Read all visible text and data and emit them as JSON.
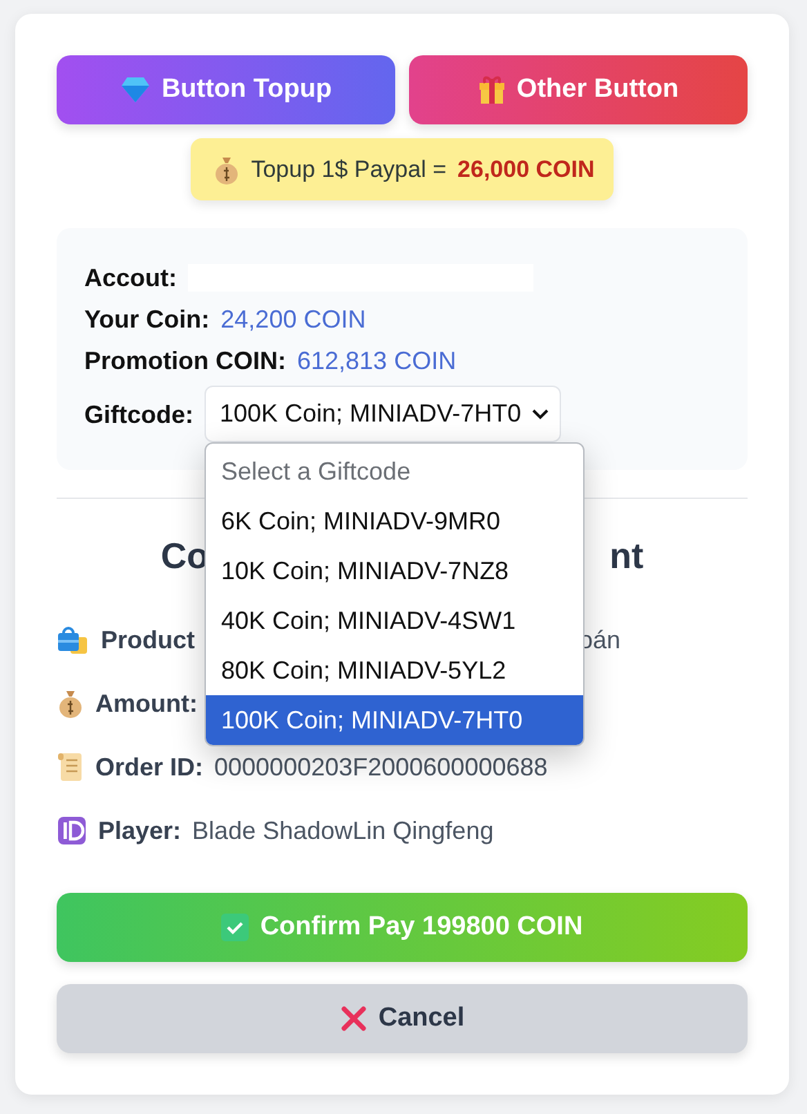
{
  "top_buttons": [
    {
      "kind": "topup",
      "label": "Button Topup"
    },
    {
      "kind": "other",
      "label": "Other Button"
    }
  ],
  "rate": {
    "text": "Topup 1$ Paypal =",
    "amount": "26,000 COIN"
  },
  "account": {
    "rows": [
      {
        "kind": "blank",
        "label": "Accout:"
      },
      {
        "kind": "coin",
        "label": "Your Coin:",
        "value": "24,200 COIN"
      },
      {
        "kind": "coin",
        "label": "Promotion COIN:",
        "value": "612,813 COIN"
      }
    ],
    "giftcode": {
      "label": "Giftcode:",
      "value": "100K Coin; MINIADV-7HT0",
      "expanded": true,
      "placeholder": "Select a Giftcode",
      "options": [
        {
          "label": "6K Coin; MINIADV-9MR0",
          "selected": false
        },
        {
          "label": "10K Coin; MINIADV-7NZ8",
          "selected": false
        },
        {
          "label": "40K Coin; MINIADV-4SW1",
          "selected": false
        },
        {
          "label": "80K Coin; MINIADV-5YL2",
          "selected": false
        },
        {
          "label": "100K Coin; MINIADV-7HT0",
          "selected": true
        }
      ]
    }
  },
  "payment": {
    "heading_parts": [
      "Co",
      "nt"
    ],
    "details": [
      {
        "label": "Product",
        "value_tail": "oán"
      },
      {
        "label": "Amount:"
      },
      {
        "label": "Order ID:",
        "value": "0000000203F2000600000688"
      },
      {
        "label": "Player:",
        "value": "Blade ShadowLin Qingfeng"
      }
    ]
  },
  "actions": [
    {
      "kind": "confirm",
      "label": "Confirm Pay 199800 COIN"
    },
    {
      "kind": "cancel",
      "label": "Cancel"
    }
  ]
}
